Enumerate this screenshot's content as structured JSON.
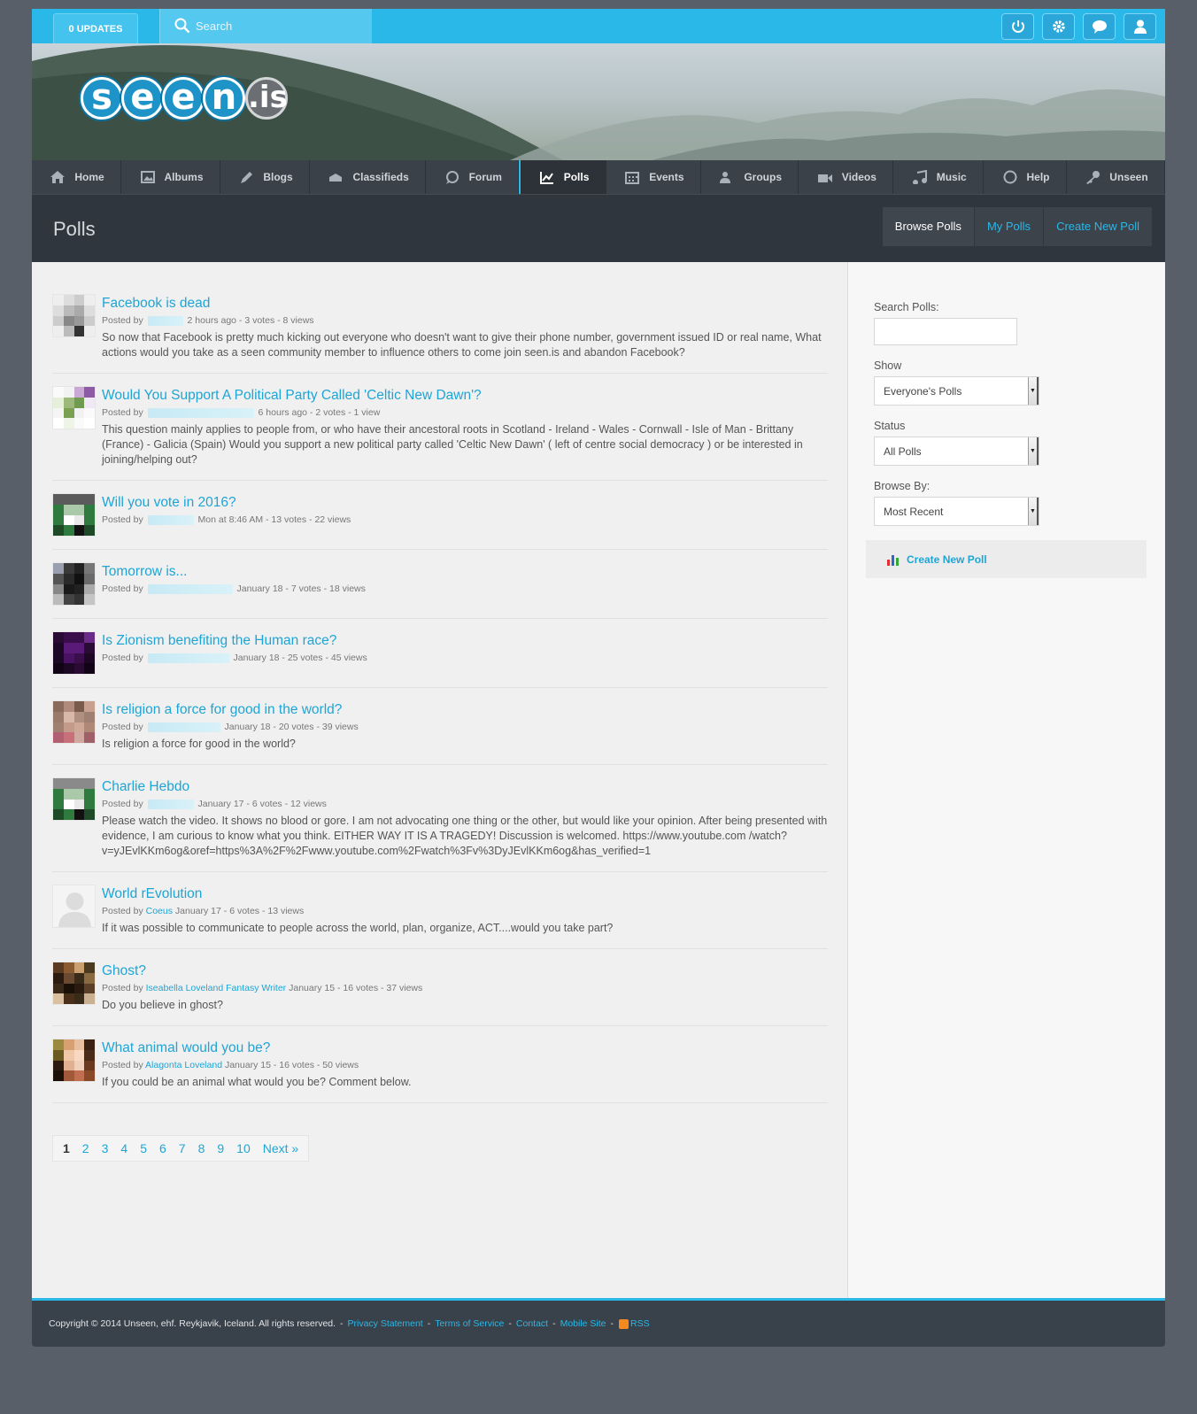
{
  "topbar": {
    "updates_label": "0 UPDATES",
    "search_placeholder": "Search",
    "icons": [
      "power-icon",
      "gear-icon",
      "chat-icon",
      "user-icon"
    ]
  },
  "logo": {
    "letters": [
      "s",
      "e",
      "e",
      "n"
    ],
    "suffix": ".is"
  },
  "nav": [
    {
      "label": "Home",
      "icon": "home-icon"
    },
    {
      "label": "Albums",
      "icon": "image-icon"
    },
    {
      "label": "Blogs",
      "icon": "pen-icon"
    },
    {
      "label": "Classifieds",
      "icon": "box-icon"
    },
    {
      "label": "Forum",
      "icon": "chat-bubble-icon"
    },
    {
      "label": "Polls",
      "icon": "chart-icon",
      "active": true
    },
    {
      "label": "Events",
      "icon": "calendar-icon"
    },
    {
      "label": "Groups",
      "icon": "group-icon"
    },
    {
      "label": "Videos",
      "icon": "video-icon"
    },
    {
      "label": "Music",
      "icon": "music-icon"
    },
    {
      "label": "Help",
      "icon": "circle-icon"
    },
    {
      "label": "Unseen",
      "icon": "key-icon"
    }
  ],
  "page": {
    "title": "Polls",
    "tabs": [
      "Browse Polls",
      "My Polls",
      "Create New Poll"
    ]
  },
  "polls": [
    {
      "title": "Facebook is dead",
      "author": "",
      "meta": "2 hours ago - 3 votes - 8 views",
      "desc": "So now that Facebook is pretty much kicking out everyone who doesn't want to give their phone number, government issued ID or real name, What actions would you take as a seen community member to influence others to come join seen.is and abandon Facebook?"
    },
    {
      "title": "Would You Support A Political Party Called 'Celtic New Dawn'?",
      "author": "",
      "meta": "6 hours ago - 2 votes - 1 view",
      "desc": "This question mainly applies to people from, or who have their ancestoral roots in Scotland - Ireland - Wales - Cornwall - Isle of Man - Brittany (France) - Galicia (Spain) Would you support a new political party called 'Celtic New Dawn' ( left of centre social democracy ) or be interested in joining/helping out?"
    },
    {
      "title": "Will you vote in 2016?",
      "author": "",
      "meta": "Mon at 8:46 AM - 13 votes - 22 views",
      "desc": ""
    },
    {
      "title": "Tomorrow is...",
      "author": "",
      "meta": "January 18 - 7 votes - 18 views",
      "desc": ""
    },
    {
      "title": "Is Zionism benefiting the Human race?",
      "author": "",
      "meta": "January 18 - 25 votes - 45 views",
      "desc": ""
    },
    {
      "title": "Is religion a force for good in the world?",
      "author": "",
      "meta": "January 18 - 20 votes - 39 views",
      "desc": "Is religion a force for good in the world?"
    },
    {
      "title": "Charlie Hebdo",
      "author": "",
      "meta": "January 17 - 6 votes - 12 views",
      "desc": "Please watch the video. It shows no blood or gore. I am not advocating one thing or the other, but would like your opinion. After being presented with evidence, I am curious to know what you think. EITHER WAY IT IS A TRAGEDY! Discussion is welcomed. https://www.youtube.com /watch?v=yJEvlKKm6og&oref=https%3A%2F%2Fwww.youtube.com%2Fwatch%3Fv%3DyJEvlKKm6og&has_verified=1"
    },
    {
      "title": "World rEvolution",
      "author": "Coeus",
      "meta": "January 17 - 6 votes - 13 views",
      "desc": "If it was possible to communicate to people across the world, plan, organize, ACT....would you take part?"
    },
    {
      "title": "Ghost?",
      "author": "Iseabella Loveland Fantasy Writer",
      "meta": "January 15 - 16 votes - 37 views",
      "desc": "Do you believe in ghost?"
    },
    {
      "title": "What animal would you be?",
      "author": "Alagonta Loveland",
      "meta": "January 15 - 16 votes - 50 views",
      "desc": "If you could be an animal what would you be? Comment below."
    }
  ],
  "posted_by_label": "Posted by",
  "pager": {
    "pages": [
      "1",
      "2",
      "3",
      "4",
      "5",
      "6",
      "7",
      "8",
      "9",
      "10"
    ],
    "next": "Next »",
    "current": "1"
  },
  "sidebar": {
    "search_label": "Search Polls:",
    "show_label": "Show",
    "show_value": "Everyone's Polls",
    "status_label": "Status",
    "status_value": "All Polls",
    "browse_label": "Browse By:",
    "browse_value": "Most Recent",
    "create_label": "Create New Poll"
  },
  "footer": {
    "copyright": "Copyright © 2014 Unseen, ehf. Reykjavik, Iceland. All rights reserved.",
    "links": [
      "Privacy Statement",
      "Terms of Service",
      "Contact",
      "Mobile Site"
    ],
    "rss": "RSS"
  },
  "colors": {
    "accent": "#29b8e8",
    "link": "#1ea5d5",
    "nav_bg": "#3a4149"
  }
}
